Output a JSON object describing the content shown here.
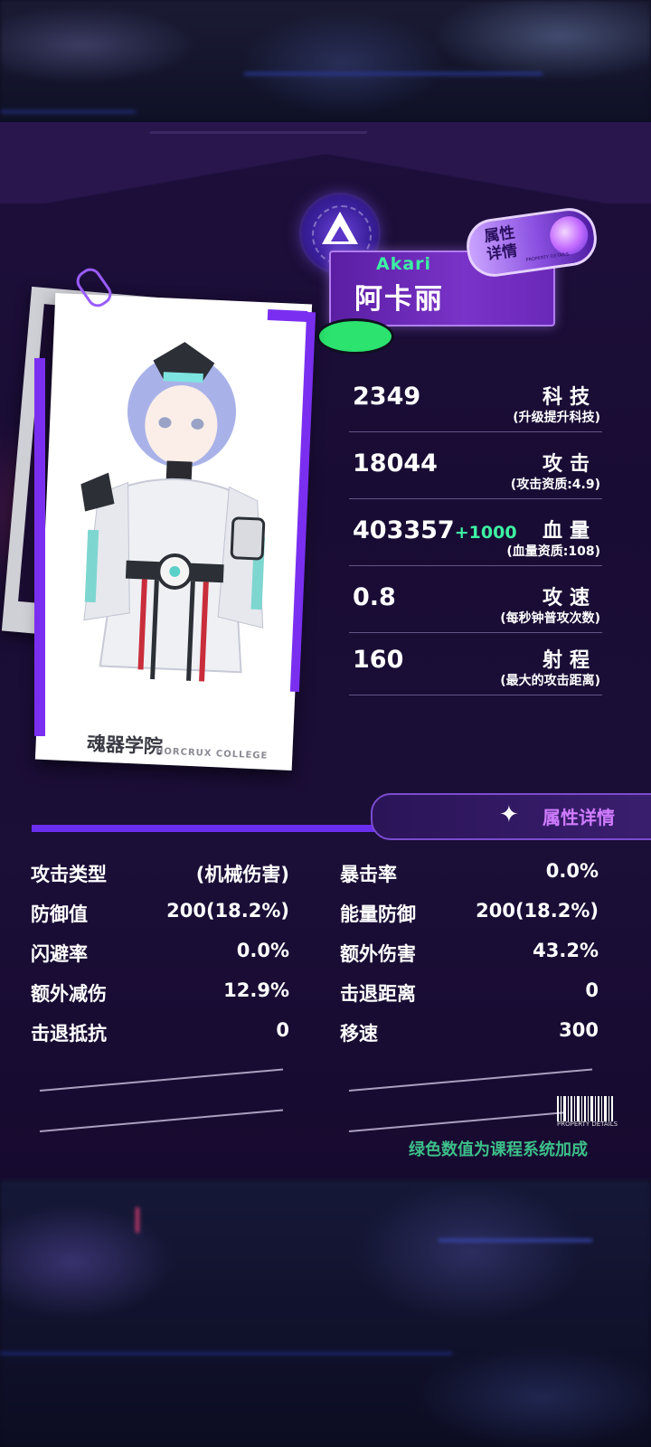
{
  "character": {
    "name_en": "Akari",
    "name_cn": "阿卡丽",
    "card_caption": "魂器学院",
    "card_caption_sub": "HORCRUX COLLEGE"
  },
  "badge": {
    "label_line1": "属性",
    "label_line2": "详情",
    "sub": "PROPERTY DETAILS"
  },
  "stats": [
    {
      "value": "2349",
      "bonus": "",
      "name": "科技",
      "sub": "(升级提升科技)"
    },
    {
      "value": "18044",
      "bonus": "",
      "name": "攻击",
      "sub": "(攻击资质:4.9)"
    },
    {
      "value": "403357",
      "bonus": "+1000",
      "name": "血量",
      "sub": "(血量资质:108)"
    },
    {
      "value": "0.8",
      "bonus": "",
      "name": "攻速",
      "sub": "(每秒钟普攻次数)"
    },
    {
      "value": "160",
      "bonus": "",
      "name": "射程",
      "sub": "(最大的攻击距离)"
    }
  ],
  "details_header": {
    "label": "属性详情"
  },
  "attributes_left": [
    {
      "name": "攻击类型",
      "value": "(机械伤害)"
    },
    {
      "name": "防御值",
      "value": "200(18.2%)"
    },
    {
      "name": "闪避率",
      "value": "0.0%"
    },
    {
      "name": "额外减伤",
      "value": "12.9%"
    },
    {
      "name": "击退抵抗",
      "value": "0"
    }
  ],
  "attributes_right": [
    {
      "name": "暴击率",
      "value": "0.0%"
    },
    {
      "name": "能量防御",
      "value": "200(18.2%)"
    },
    {
      "name": "额外伤害",
      "value": "43.2%"
    },
    {
      "name": "击退距离",
      "value": "0"
    },
    {
      "name": "移速",
      "value": "300"
    }
  ],
  "barcode_label": "PROPERTY DETAILS",
  "footnote": "绿色数值为课程系统加成",
  "colors": {
    "accent_purple": "#7a2ff0",
    "bonus_green": "#3df2a3",
    "panel_bg": "#1b0e37"
  }
}
